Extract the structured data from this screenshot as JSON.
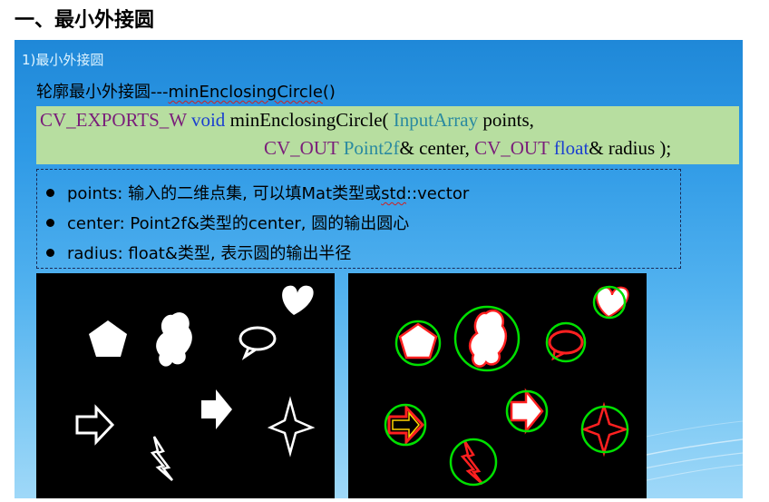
{
  "page": {
    "heading": "一、最小外接圆"
  },
  "slide": {
    "section_label": "1)最小外接圆",
    "subtitle_prefix": "轮廓最小外接圆---",
    "subtitle_func": "minEnclosingCircle",
    "subtitle_suffix": "()",
    "code": {
      "line1": [
        {
          "text": "CV_EXPORTS_W",
          "kind": "macro"
        },
        {
          "text": " ",
          "kind": "plain"
        },
        {
          "text": "void",
          "kind": "kw"
        },
        {
          "text": " minEnclosingCircle( ",
          "kind": "plain"
        },
        {
          "text": "InputArray",
          "kind": "type"
        },
        {
          "text": " points,",
          "kind": "plain"
        }
      ],
      "line2": [
        {
          "text": "CV_OUT",
          "kind": "macro"
        },
        {
          "text": " ",
          "kind": "plain"
        },
        {
          "text": "Point2f",
          "kind": "type"
        },
        {
          "text": "& center, ",
          "kind": "plain"
        },
        {
          "text": "CV_OUT",
          "kind": "macro"
        },
        {
          "text": " ",
          "kind": "plain"
        },
        {
          "text": "float",
          "kind": "kw"
        },
        {
          "text": "& radius );",
          "kind": "plain"
        }
      ]
    },
    "params": [
      {
        "prefix": "points: 输入的二维点集, 可以填Mat类型或",
        "squiggle": "std",
        "suffix": "::vector"
      },
      {
        "prefix": "center: Point2f&类型的center, 圆的输出圆心",
        "squiggle": "",
        "suffix": ""
      },
      {
        "prefix": "radius: float&类型, 表示圆的输出半径",
        "squiggle": "",
        "suffix": ""
      }
    ]
  },
  "figures": {
    "left_panel": {
      "description_shapes": [
        "pentagon",
        "blob",
        "speech-bubble",
        "heart",
        "outline-arrow",
        "solid-arrow",
        "lightning",
        "four-point-star"
      ]
    },
    "right_panel": {
      "circle_color": "#00e000",
      "outline_color": "#ff2020"
    }
  },
  "colors": {
    "slide_top": "#1f88d8",
    "slide_bottom": "#9fd8f8",
    "code_bg": "#b7dea0",
    "macro": "#7a1e7a",
    "keyword": "#1a3fd0",
    "type": "#2a8aa0"
  }
}
